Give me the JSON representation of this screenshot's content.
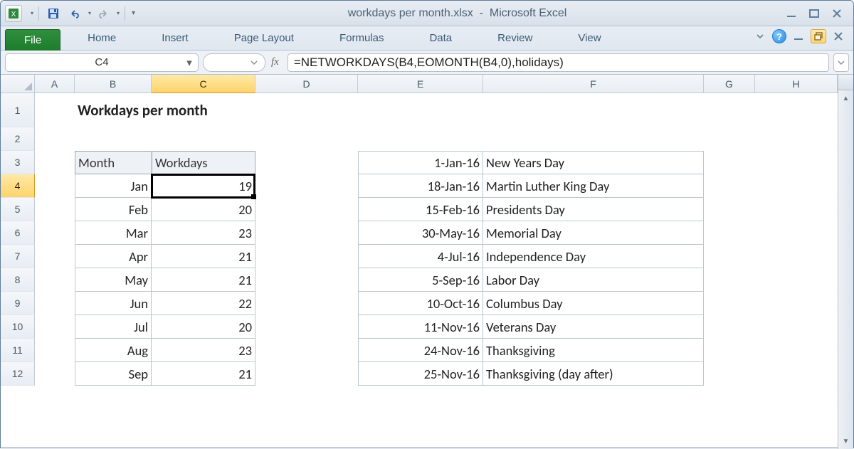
{
  "window": {
    "title_file": "workdays per month.xlsx",
    "title_app": "Microsoft Excel"
  },
  "tabs": {
    "file": "File",
    "items": [
      "Home",
      "Insert",
      "Page Layout",
      "Formulas",
      "Data",
      "Review",
      "View"
    ]
  },
  "formula_bar": {
    "name_box": "C4",
    "fx_label": "fx",
    "formula": "=NETWORKDAYS(B4,EOMONTH(B4,0),holidays)"
  },
  "columns": {
    "widths": {
      "A": 56,
      "B": 108,
      "C": 146,
      "D": 144,
      "E": 176,
      "F": 310,
      "G": 72,
      "H": 116
    },
    "labels": [
      "A",
      "B",
      "C",
      "D",
      "E",
      "F",
      "G",
      "H"
    ]
  },
  "row_heights": {
    "r1": 48,
    "default": 33
  },
  "visible_rows": [
    "1",
    "2",
    "3",
    "4",
    "5",
    "6",
    "7",
    "8",
    "9",
    "10",
    "11",
    "12"
  ],
  "selected": {
    "col": "C",
    "row": "4"
  },
  "sheet": {
    "title": "Workdays per month",
    "table1": {
      "headers": [
        "Month",
        "Workdays"
      ],
      "rows": [
        {
          "month": "Jan",
          "workdays": "19"
        },
        {
          "month": "Feb",
          "workdays": "20"
        },
        {
          "month": "Mar",
          "workdays": "23"
        },
        {
          "month": "Apr",
          "workdays": "21"
        },
        {
          "month": "May",
          "workdays": "21"
        },
        {
          "month": "Jun",
          "workdays": "22"
        },
        {
          "month": "Jul",
          "workdays": "20"
        },
        {
          "month": "Aug",
          "workdays": "23"
        },
        {
          "month": "Sep",
          "workdays": "21"
        }
      ]
    },
    "table2": {
      "rows": [
        {
          "date": "1-Jan-16",
          "name": "New Years Day"
        },
        {
          "date": "18-Jan-16",
          "name": "Martin Luther King Day"
        },
        {
          "date": "15-Feb-16",
          "name": "Presidents Day"
        },
        {
          "date": "30-May-16",
          "name": "Memorial Day"
        },
        {
          "date": "4-Jul-16",
          "name": "Independence Day"
        },
        {
          "date": "5-Sep-16",
          "name": "Labor Day"
        },
        {
          "date": "10-Oct-16",
          "name": "Columbus Day"
        },
        {
          "date": "11-Nov-16",
          "name": "Veterans Day"
        },
        {
          "date": "24-Nov-16",
          "name": "Thanksgiving"
        },
        {
          "date": "25-Nov-16",
          "name": "Thanksgiving (day after)"
        }
      ]
    }
  }
}
